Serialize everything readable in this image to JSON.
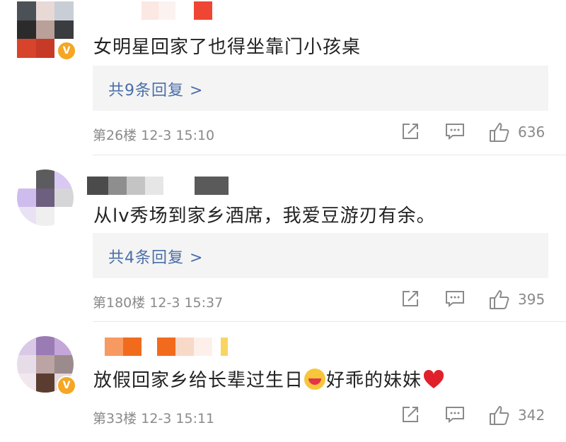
{
  "colors": {
    "reply_link": "#4a6ea8",
    "meta_text": "#8a8a8a",
    "reply_bg": "#f4f4f4",
    "verified_badge": "#f5a623"
  },
  "comments": [
    {
      "text": "女明星回家了也得坐靠门小孩桌",
      "reply_label": "共9条回复 >",
      "floor": "第26楼",
      "time": "12-3 15:10",
      "likes": "636",
      "verified": true,
      "icons": [
        "share-icon",
        "comment-icon",
        "like-icon"
      ]
    },
    {
      "text": "从lv秀场到家乡酒席，我爱豆游刃有余。",
      "reply_label": "共4条回复 >",
      "floor": "第180楼",
      "time": "12-3 15:37",
      "likes": "395",
      "verified": false,
      "icons": [
        "share-icon",
        "comment-icon",
        "like-icon"
      ]
    },
    {
      "text_before": "放假回家乡给长辈过生日",
      "text_middle": "好乖的妹妹",
      "emoji_1": "kiss-face-emoji",
      "emoji_2": "red-heart-emoji",
      "floor": "第33楼",
      "time": "12-3 15:11",
      "likes": "342",
      "verified": true,
      "icons": [
        "share-icon",
        "comment-icon",
        "like-icon"
      ]
    }
  ]
}
